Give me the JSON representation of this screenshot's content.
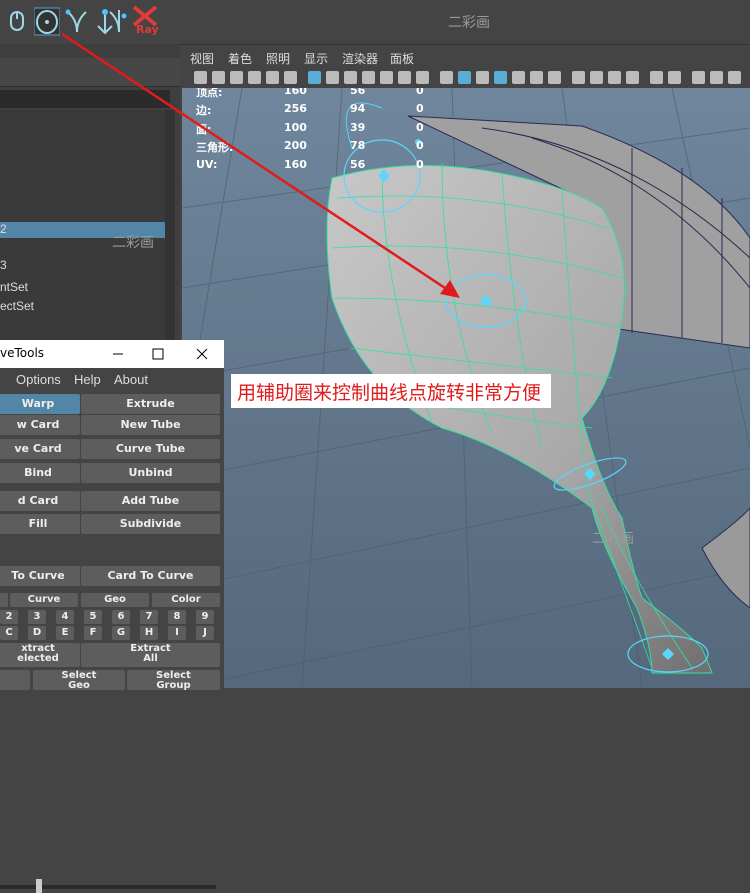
{
  "shelf": {
    "icons": [
      "mouse-icon",
      "circle-target-icon",
      "curve-down-icon",
      "curve-tool-icon",
      "curve-tool-2-icon",
      "vray-logo-icon"
    ],
    "vray_label": "Ray",
    "watermark": "二彩画"
  },
  "left_panel": {
    "items": [
      "2",
      "3",
      "ntSet",
      "ectSet"
    ],
    "selected_index": 0
  },
  "viewport_menu": [
    "视图",
    "着色",
    "照明",
    "显示",
    "渲染器",
    "面板"
  ],
  "hud": {
    "rows": [
      {
        "label": "顶点:",
        "a": "160",
        "b": "56",
        "c": "0"
      },
      {
        "label": "边:",
        "a": "256",
        "b": "94",
        "c": "0"
      },
      {
        "label": "面:",
        "a": "100",
        "b": "39",
        "c": "0"
      },
      {
        "label": "三角形:",
        "a": "200",
        "b": "78",
        "c": "0"
      },
      {
        "label": "UV:",
        "a": "160",
        "b": "56",
        "c": "0"
      }
    ]
  },
  "annotation": {
    "text": "用辅助圈来控制曲线点旋转非常方便",
    "color": "#e01b1b"
  },
  "curvetools": {
    "title": "veTools",
    "menu": [
      "Options",
      "Help",
      "About"
    ],
    "rows": [
      [
        "Warp",
        "Extrude"
      ],
      [
        "w Card",
        "New Tube"
      ],
      [
        "ve Card",
        "Curve Tube"
      ],
      [
        "Bind",
        "Unbind"
      ],
      [
        "d Card",
        "Add Tube"
      ],
      [
        "Fill",
        "Subdivide"
      ]
    ],
    "active": "Warp",
    "convert": [
      "To Curve",
      "Card To Curve"
    ],
    "select_row": [
      "Curve",
      "Geo",
      "Color"
    ],
    "numbers": [
      "2",
      "3",
      "4",
      "5",
      "6",
      "7",
      "8",
      "9"
    ],
    "letters": [
      "C",
      "D",
      "E",
      "F",
      "G",
      "H",
      "I",
      "J"
    ],
    "extract_left": [
      "xtract",
      "elected"
    ],
    "extract_right": [
      "Extract",
      "All"
    ],
    "select_bottom_a": [
      "Select",
      "Geo"
    ],
    "select_bottom_b": [
      "Select",
      "Group"
    ]
  },
  "colors": {
    "ui_bg": "#444444",
    "viewport_sky": "#6b8299",
    "selection_blue": "#5285a6",
    "wire_green": "#33e0a0",
    "handle_cyan": "#5ad6ff",
    "arrow_red": "#e01b1b"
  }
}
